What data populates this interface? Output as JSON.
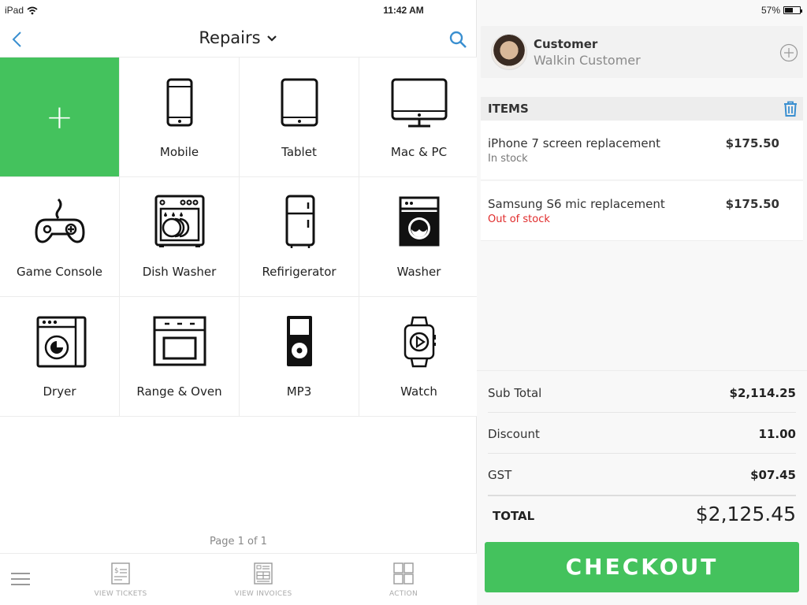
{
  "status_bar": {
    "device": "iPad",
    "time": "11:42 AM",
    "battery_percent_label": "57%",
    "battery_level": 0.57
  },
  "nav": {
    "title": "Repairs",
    "back_icon": "chevron-left-icon",
    "search_icon": "search-icon"
  },
  "categories": [
    {
      "label": "+",
      "icon": "plus-icon"
    },
    {
      "label": "Mobile",
      "icon": "mobile-phone-icon"
    },
    {
      "label": "Tablet",
      "icon": "tablet-icon"
    },
    {
      "label": "Mac & PC",
      "icon": "desktop-monitor-icon"
    },
    {
      "label": "Game Console",
      "icon": "gamepad-icon"
    },
    {
      "label": "Dish Washer",
      "icon": "dishwasher-icon"
    },
    {
      "label": "Refirigerator",
      "icon": "refrigerator-icon"
    },
    {
      "label": "Washer",
      "icon": "washing-machine-icon"
    },
    {
      "label": "Dryer",
      "icon": "dryer-icon"
    },
    {
      "label": "Range & Oven",
      "icon": "oven-icon"
    },
    {
      "label": "MP3",
      "icon": "mp3-player-icon"
    },
    {
      "label": "Watch",
      "icon": "smartwatch-icon"
    }
  ],
  "pagination": {
    "label": "Page 1 of 1"
  },
  "tabbar": {
    "tabs": [
      {
        "label": "VIEW TICKETS",
        "icon": "ticket-icon"
      },
      {
        "label": "VIEW INVOICES",
        "icon": "invoice-icon"
      },
      {
        "label": "ACTION",
        "icon": "grid-icon"
      }
    ]
  },
  "customer": {
    "label": "Customer",
    "name": "Walkin Customer"
  },
  "items": {
    "header": "ITEMS",
    "list": [
      {
        "name": "iPhone 7 screen replacement",
        "stock": "In stock",
        "stock_color": "#777777",
        "price": "$175.50"
      },
      {
        "name": "Samsung S6 mic replacement",
        "stock": "Out of stock",
        "stock_color": "#e02b2b",
        "price": "$175.50"
      }
    ]
  },
  "totals": {
    "rows": [
      {
        "label": "Sub Total",
        "value": "$2,114.25"
      },
      {
        "label": "Discount",
        "value": "11.00"
      },
      {
        "label": "GST",
        "value": "$07.45"
      }
    ],
    "total_label": "TOTAL",
    "total_value": "$2,125.45"
  },
  "checkout": {
    "label": "CHECKOUT"
  },
  "colors": {
    "accent_green": "#44c25d",
    "link_blue": "#3a8fd0",
    "out_of_stock_red": "#e02b2b"
  }
}
